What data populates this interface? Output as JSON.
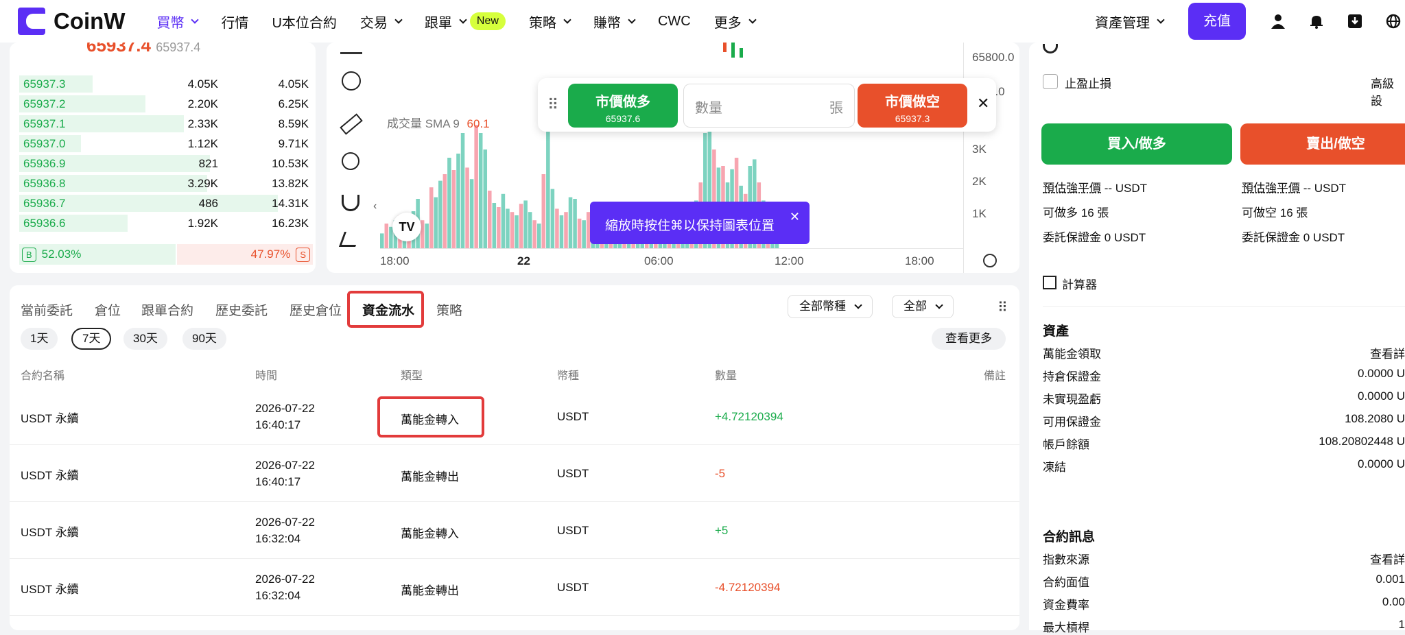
{
  "nav": {
    "logo": "CoinW",
    "items": [
      {
        "label": "買幣",
        "caret": true,
        "active": true
      },
      {
        "label": "行情",
        "caret": false
      },
      {
        "label": "U本位合約",
        "caret": false
      },
      {
        "label": "交易",
        "caret": true
      },
      {
        "label": "跟單",
        "caret": true,
        "badge": "New"
      },
      {
        "label": "策略",
        "caret": true
      },
      {
        "label": "賺幣",
        "caret": true
      },
      {
        "label": "CWC",
        "caret": false
      },
      {
        "label": "更多",
        "caret": true
      }
    ],
    "asset_mgmt": "資產管理",
    "deposit": "充值"
  },
  "orderbook": {
    "last_price": "65937.4",
    "last_price_sub": "65937.4",
    "rows": [
      {
        "price": "65937.3",
        "qty": "4.05K",
        "total": "4.05K",
        "depth": 0.25
      },
      {
        "price": "65937.2",
        "qty": "2.20K",
        "total": "6.25K",
        "depth": 0.43
      },
      {
        "price": "65937.1",
        "qty": "2.33K",
        "total": "8.59K",
        "depth": 0.56
      },
      {
        "price": "65937.0",
        "qty": "1.12K",
        "total": "9.71K",
        "depth": 0.21
      },
      {
        "price": "65936.9",
        "qty": "821",
        "total": "10.53K",
        "depth": 0.65
      },
      {
        "price": "65936.8",
        "qty": "3.29K",
        "total": "13.82K",
        "depth": 0.64
      },
      {
        "price": "65936.7",
        "qty": "486",
        "total": "14.31K",
        "depth": 0.88
      },
      {
        "price": "65936.6",
        "qty": "1.92K",
        "total": "16.23K",
        "depth": 0.37
      }
    ],
    "buy_badge": "B",
    "buy_ratio": "52.03%",
    "sell_ratio": "47.97%",
    "sell_badge": "S"
  },
  "chart": {
    "volume_label": "成交量 SMA 9",
    "volume_value": "60.1",
    "y_ticks": [
      "65800.0",
      "0.0",
      "3K",
      "2K",
      "1K"
    ],
    "x_ticks": [
      "18:00",
      "22",
      "06:00",
      "12:00",
      "18:00"
    ],
    "volumes": [
      18,
      30,
      26,
      34,
      40,
      30,
      26,
      45,
      60,
      34,
      30,
      74,
      62,
      82,
      90,
      110,
      95,
      115,
      140,
      98,
      84,
      150,
      140,
      120,
      70,
      55,
      50,
      66,
      48,
      44,
      40,
      54,
      58,
      44,
      34,
      30,
      90,
      160,
      72,
      48,
      40,
      44,
      62,
      60,
      36,
      34,
      44,
      40,
      48,
      34,
      30,
      40,
      38,
      30,
      36,
      34,
      42,
      40,
      30,
      30,
      26,
      36,
      38,
      40,
      32,
      28,
      38,
      36,
      30,
      54,
      58,
      80,
      140,
      155,
      120,
      98,
      100,
      80,
      96,
      110,
      76,
      66,
      100,
      108,
      80,
      58,
      46,
      30,
      12
    ],
    "volume_colors": "mixed",
    "green": "#7dd3c0",
    "red": "#f7a5b0"
  },
  "quick_trade": {
    "long_label": "市價做多",
    "long_price": "65937.6",
    "qty_placeholder": "數量",
    "qty_unit": "張",
    "short_label": "市價做空",
    "short_price": "65937.3",
    "close": "✕"
  },
  "zoom_tip": {
    "text": "縮放時按住⌘以保持圖表位置",
    "close": "✕"
  },
  "records": {
    "tabs": [
      "當前委託",
      "倉位",
      "跟單合約",
      "歷史委託",
      "歷史倉位",
      "資金流水",
      "策略"
    ],
    "active_tab": "資金流水",
    "currency_filter": "全部幣種",
    "type_filter": "全部",
    "ranges": [
      "1天",
      "7天",
      "30天",
      "90天"
    ],
    "active_range": "7天",
    "view_more": "查看更多",
    "columns": [
      "合約名稱",
      "時間",
      "類型",
      "幣種",
      "數量",
      "備註"
    ],
    "rows": [
      {
        "contract": "USDT 永續",
        "date": "2026-07-22",
        "time": "16:40:17",
        "type": "萬能金轉入",
        "coin": "USDT",
        "amount": "+4.72120394",
        "dir": "in"
      },
      {
        "contract": "USDT 永續",
        "date": "2026-07-22",
        "time": "16:40:17",
        "type": "萬能金轉出",
        "coin": "USDT",
        "amount": "-5",
        "dir": "out"
      },
      {
        "contract": "USDT 永續",
        "date": "2026-07-22",
        "time": "16:32:04",
        "type": "萬能金轉入",
        "coin": "USDT",
        "amount": "+5",
        "dir": "in"
      },
      {
        "contract": "USDT 永續",
        "date": "2026-07-22",
        "time": "16:32:04",
        "type": "萬能金轉出",
        "coin": "USDT",
        "amount": "-4.72120394",
        "dir": "out"
      }
    ]
  },
  "trade_panel": {
    "tpsl": "止盈止損",
    "advanced": "高級設",
    "buy": "買入/做多",
    "sell": "賣出/做空",
    "left": [
      {
        "k": "預估強平價",
        "v": "-- USDT"
      },
      {
        "k": "可做多",
        "v": "16 張"
      },
      {
        "k": "委託保證金",
        "v": "0 USDT"
      }
    ],
    "right": [
      {
        "k": "預估強平價",
        "v": "-- USDT"
      },
      {
        "k": "可做空",
        "v": "16 張"
      },
      {
        "k": "委託保證金",
        "v": "0 USDT"
      }
    ],
    "calculator": "計算器",
    "assets_title": "資產",
    "assets": [
      {
        "k": "萬能金領取",
        "v": "查看詳"
      },
      {
        "k": "持倉保證金",
        "v": "0.0000 U"
      },
      {
        "k": "未實現盈虧",
        "v": "0.0000 U"
      },
      {
        "k": "可用保證金",
        "v": "108.2080 U"
      },
      {
        "k": "帳戶餘額",
        "v": "108.20802448 U"
      },
      {
        "k": "凍結",
        "v": "0.0000 U"
      }
    ],
    "contract_title": "合約訊息",
    "contract": [
      {
        "k": "指數來源",
        "v": "查看詳"
      },
      {
        "k": "合約面值",
        "v": "0.001"
      },
      {
        "k": "資金費率",
        "v": "0.00"
      },
      {
        "k": "最大槓桿",
        "v": "1"
      }
    ]
  },
  "colors": {
    "brand": "#5b2ef5",
    "green": "#1aab4b",
    "red": "#e8502b",
    "highlight": "#e23b3b"
  }
}
